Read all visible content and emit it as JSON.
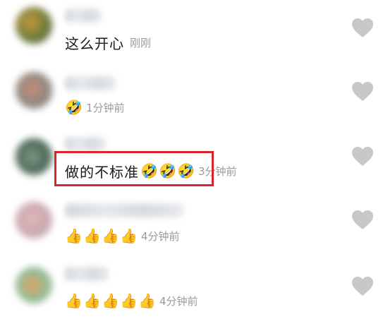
{
  "comments": [
    {
      "text": "这么开心",
      "time": "刚刚",
      "emojis": [],
      "emoji_glyph": ""
    },
    {
      "text": "",
      "time": "1分钟前",
      "emojis": [
        "🤣"
      ],
      "emoji_glyph": "🤣"
    },
    {
      "text": "做的不标准",
      "time": "3分钟前",
      "emojis": [
        "🤣",
        "🤣",
        "🤣"
      ],
      "emoji_glyph": "🤣"
    },
    {
      "text": "",
      "time": "4分钟前",
      "emojis": [
        "👍",
        "👍",
        "👍",
        "👍"
      ],
      "emoji_glyph": "👍"
    },
    {
      "text": "",
      "time": "4分钟前",
      "emojis": [
        "👍",
        "👍",
        "👍",
        "👍",
        "👍"
      ],
      "emoji_glyph": "👍"
    }
  ],
  "icons": {
    "like": "heart-icon",
    "laugh": "rolling-on-floor-laughing-emoji",
    "thumbs": "thumbs-up-emoji"
  },
  "colors": {
    "highlight_border": "#d9262c",
    "time_text": "#9a9a9a",
    "heart": "#c8c8c8"
  }
}
